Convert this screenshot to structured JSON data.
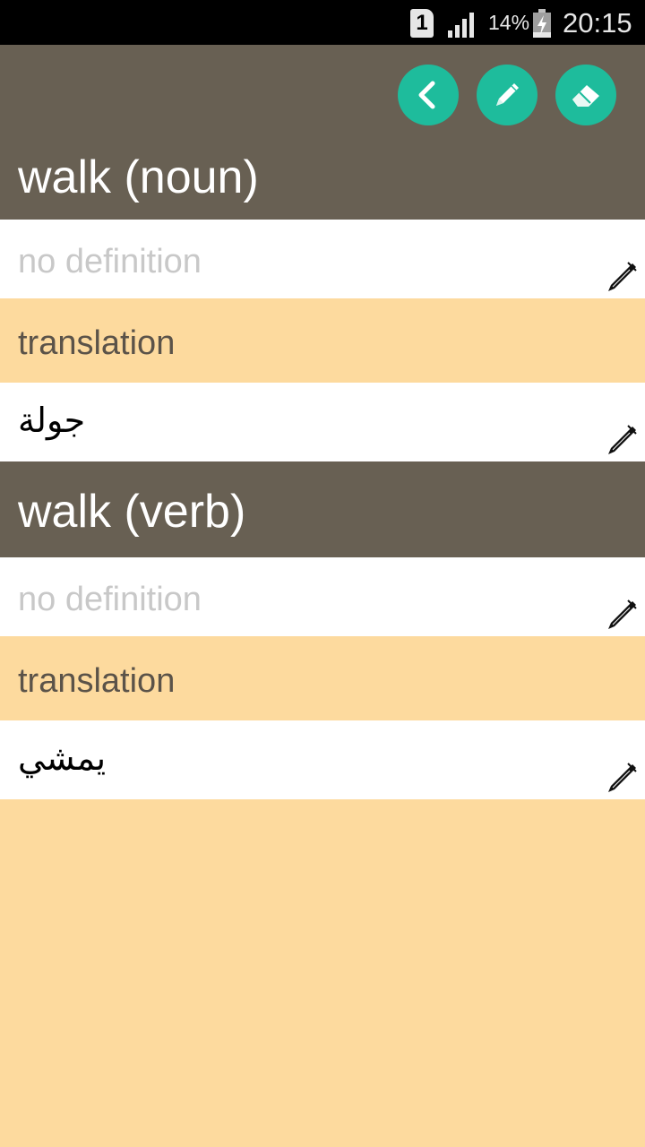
{
  "status_bar": {
    "sim_slot": "1",
    "battery_percent": "14%",
    "time": "20:15"
  },
  "toolbar": {
    "back_icon": "chevron-left-icon",
    "edit_icon": "pen-icon",
    "erase_icon": "eraser-icon",
    "accent_color": "#1EBC9C"
  },
  "entries": [
    {
      "title": "walk (noun)",
      "definition_placeholder": "no definition",
      "translation_label": "translation",
      "translation_value": "جولة"
    },
    {
      "title": "walk (verb)",
      "definition_placeholder": "no definition",
      "translation_label": "translation",
      "translation_value": "يمشي"
    }
  ],
  "colors": {
    "header_bg": "#686053",
    "section_bg": "#FDDA9E",
    "row_bg": "#FFFFFF"
  }
}
